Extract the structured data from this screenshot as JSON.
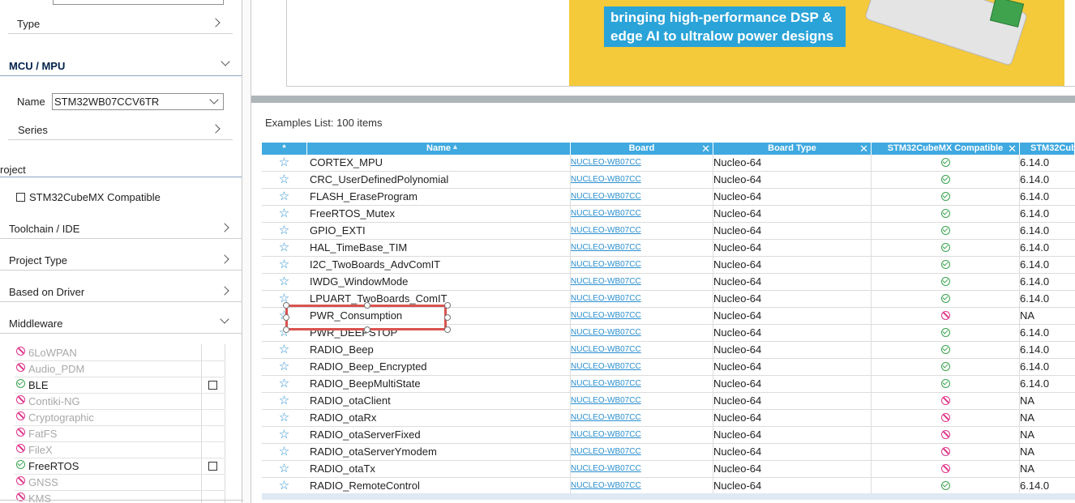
{
  "filters": {
    "type_label": "Type",
    "mcu_section": "MCU / MPU",
    "name_label": "Name",
    "name_value": "STM32WB07CCV6TR",
    "series_label": "Series",
    "project_section": "roject",
    "compat_label": "STM32CubeMX Compatible",
    "toolchain_label": "Toolchain / IDE",
    "project_type_label": "Project Type",
    "based_on_driver_label": "Based on Driver",
    "middleware_label": "Middleware"
  },
  "middleware": [
    {
      "label": "6LoWPAN",
      "enabled": false
    },
    {
      "label": "Audio_PDM",
      "enabled": false
    },
    {
      "label": "BLE",
      "enabled": true
    },
    {
      "label": "Contiki-NG",
      "enabled": false
    },
    {
      "label": "Cryptographic",
      "enabled": false
    },
    {
      "label": "FatFS",
      "enabled": false
    },
    {
      "label": "FileX",
      "enabled": false
    },
    {
      "label": "FreeRTOS",
      "enabled": true
    },
    {
      "label": "GNSS",
      "enabled": false
    },
    {
      "label": "KMS",
      "enabled": false
    }
  ],
  "banner": {
    "line1": "bringing high-performance DSP &",
    "line2": "edge AI to ultralow power designs"
  },
  "examples": {
    "count_text": "Examples List: 100 items",
    "columns": {
      "star": "*",
      "name": "Name",
      "board": "Board",
      "board_type": "Board Type",
      "compat": "STM32CubeMX Compatible",
      "version": "STM32Cub"
    },
    "rows": [
      {
        "name": "CORTEX_MPU",
        "board": "NUCLEO-WB07CC",
        "board_type": "Nucleo-64",
        "compatible": true,
        "version": "6.14.0"
      },
      {
        "name": "CRC_UserDefinedPolynomial",
        "board": "NUCLEO-WB07CC",
        "board_type": "Nucleo-64",
        "compatible": true,
        "version": "6.14.0"
      },
      {
        "name": "FLASH_EraseProgram",
        "board": "NUCLEO-WB07CC",
        "board_type": "Nucleo-64",
        "compatible": true,
        "version": "6.14.0"
      },
      {
        "name": "FreeRTOS_Mutex",
        "board": "NUCLEO-WB07CC",
        "board_type": "Nucleo-64",
        "compatible": true,
        "version": "6.14.0"
      },
      {
        "name": "GPIO_EXTI",
        "board": "NUCLEO-WB07CC",
        "board_type": "Nucleo-64",
        "compatible": true,
        "version": "6.14.0"
      },
      {
        "name": "HAL_TimeBase_TIM",
        "board": "NUCLEO-WB07CC",
        "board_type": "Nucleo-64",
        "compatible": true,
        "version": "6.14.0"
      },
      {
        "name": "I2C_TwoBoards_AdvComIT",
        "board": "NUCLEO-WB07CC",
        "board_type": "Nucleo-64",
        "compatible": true,
        "version": "6.14.0"
      },
      {
        "name": "IWDG_WindowMode",
        "board": "NUCLEO-WB07CC",
        "board_type": "Nucleo-64",
        "compatible": true,
        "version": "6.14.0"
      },
      {
        "name": "LPUART_TwoBoards_ComIT",
        "board": "NUCLEO-WB07CC",
        "board_type": "Nucleo-64",
        "compatible": true,
        "version": "6.14.0"
      },
      {
        "name": "PWR_Consumption",
        "board": "NUCLEO-WB07CC",
        "board_type": "Nucleo-64",
        "compatible": false,
        "version": "NA"
      },
      {
        "name": "PWR_DEEPSTOP",
        "board": "NUCLEO-WB07CC",
        "board_type": "Nucleo-64",
        "compatible": true,
        "version": "6.14.0"
      },
      {
        "name": "RADIO_Beep",
        "board": "NUCLEO-WB07CC",
        "board_type": "Nucleo-64",
        "compatible": true,
        "version": "6.14.0"
      },
      {
        "name": "RADIO_Beep_Encrypted",
        "board": "NUCLEO-WB07CC",
        "board_type": "Nucleo-64",
        "compatible": true,
        "version": "6.14.0"
      },
      {
        "name": "RADIO_BeepMultiState",
        "board": "NUCLEO-WB07CC",
        "board_type": "Nucleo-64",
        "compatible": true,
        "version": "6.14.0"
      },
      {
        "name": "RADIO_otaClient",
        "board": "NUCLEO-WB07CC",
        "board_type": "Nucleo-64",
        "compatible": false,
        "version": "NA"
      },
      {
        "name": "RADIO_otaRx",
        "board": "NUCLEO-WB07CC",
        "board_type": "Nucleo-64",
        "compatible": false,
        "version": "NA"
      },
      {
        "name": "RADIO_otaServerFixed",
        "board": "NUCLEO-WB07CC",
        "board_type": "Nucleo-64",
        "compatible": false,
        "version": "NA"
      },
      {
        "name": "RADIO_otaServerYmodem",
        "board": "NUCLEO-WB07CC",
        "board_type": "Nucleo-64",
        "compatible": false,
        "version": "NA"
      },
      {
        "name": "RADIO_otaTx",
        "board": "NUCLEO-WB07CC",
        "board_type": "Nucleo-64",
        "compatible": false,
        "version": "NA"
      },
      {
        "name": "RADIO_RemoteControl",
        "board": "NUCLEO-WB07CC",
        "board_type": "Nucleo-64",
        "compatible": true,
        "version": "6.14.0"
      }
    ]
  },
  "colors": {
    "header_blue": "#3fa9e0",
    "ok_green": "#3aa350",
    "na_pink": "#e0348b",
    "highlight_red": "#d9534f",
    "banner_yellow": "#f4c93a"
  }
}
